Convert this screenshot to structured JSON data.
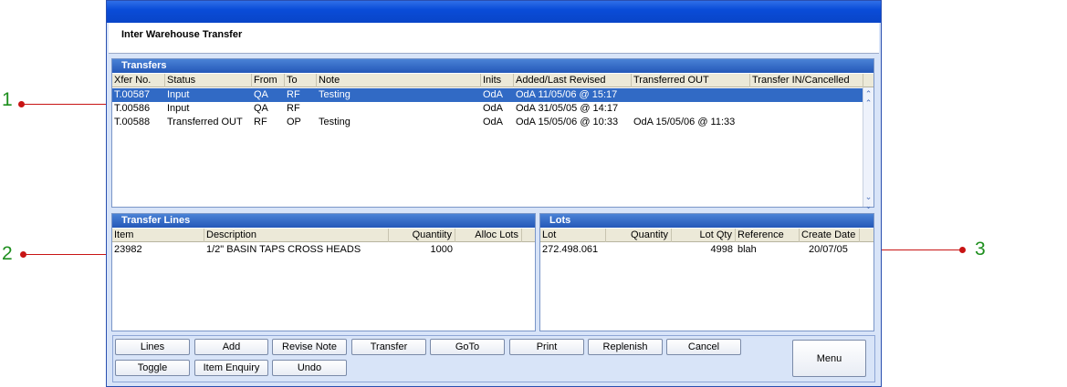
{
  "annotations": [
    "1",
    "2",
    "3"
  ],
  "window": {
    "title": "Inter Warehouse Transfer"
  },
  "transfers": {
    "heading": "Transfers",
    "columns": [
      "Xfer No.",
      "Status",
      "From",
      "To",
      "Note",
      "Inits",
      "Added/Last Revised",
      "Transferred OUT",
      "Transfer IN/Cancelled"
    ],
    "rows": [
      [
        "T.00587",
        "Input",
        "QA",
        "RF",
        "Testing",
        "OdA",
        "OdA 11/05/06 @ 15:17",
        "",
        ""
      ],
      [
        "T.00586",
        "Input",
        "QA",
        "RF",
        "",
        "OdA",
        "OdA 31/05/05 @ 14:17",
        "",
        ""
      ],
      [
        "T.00588",
        "Transferred OUT",
        "RF",
        "OP",
        "Testing",
        "OdA",
        "OdA 15/05/06 @ 10:33",
        "OdA 15/05/06 @ 11:33",
        ""
      ]
    ],
    "selected_row": 0
  },
  "transfer_lines": {
    "heading": "Transfer Lines",
    "columns": [
      "Item",
      "Description",
      "Quantiity",
      "Alloc Lots"
    ],
    "rows": [
      [
        "23982",
        "1/2\" BASIN TAPS CROSS HEADS",
        "1000",
        ""
      ]
    ]
  },
  "lots": {
    "heading": "Lots",
    "columns": [
      "Lot",
      "Quantity",
      "Lot Qty",
      "Reference",
      "Create Date"
    ],
    "rows": [
      [
        "272.498.061",
        "",
        "4998",
        "blah",
        "20/07/05"
      ]
    ]
  },
  "buttons": {
    "lines": "Lines",
    "add": "Add",
    "revise_note": "Revise Note",
    "transfer": "Transfer",
    "goto": "GoTo",
    "print": "Print",
    "replenish": "Replenish",
    "cancel": "Cancel",
    "toggle": "Toggle",
    "item_enquiry": "Item Enquiry",
    "undo": "Undo",
    "menu": "Menu"
  },
  "icons": {
    "scroll_up": "double-chevron-up-icon",
    "scroll_down": "double-chevron-down-icon"
  },
  "colors": {
    "title_blue": "#0a4cd8",
    "selection": "#316ac5",
    "annotation_number": "#1e8f1e",
    "annotation_arrow": "#c81414"
  }
}
